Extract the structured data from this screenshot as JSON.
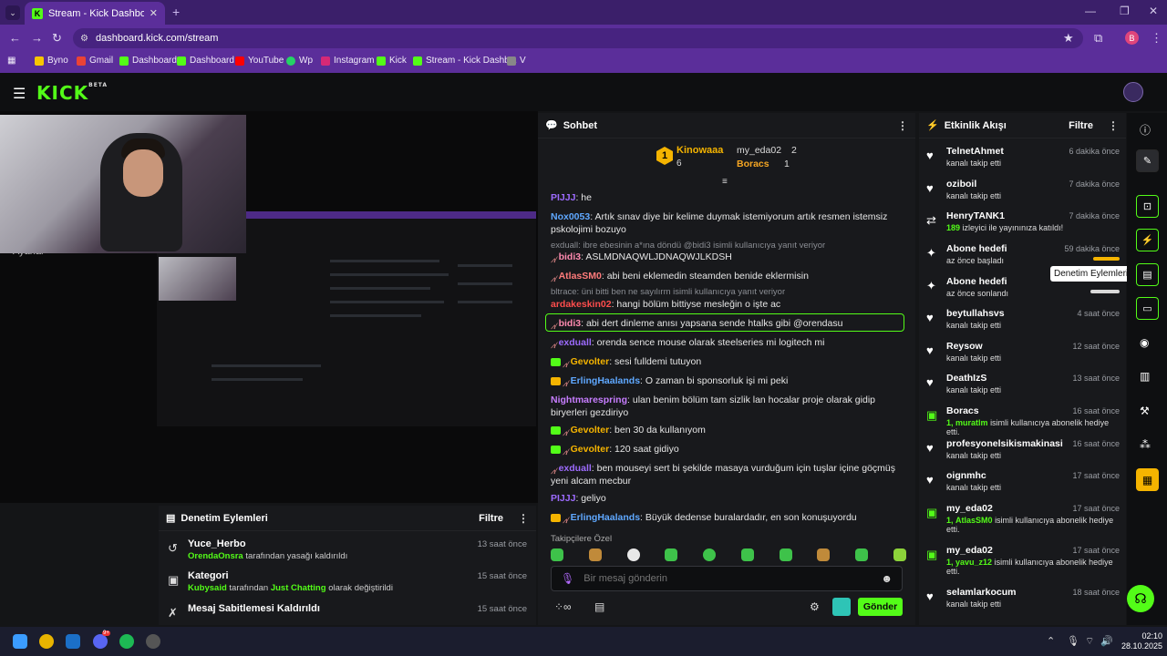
{
  "browser": {
    "tab_title": "Stream - Kick Dashboard",
    "url": "dashboard.kick.com/stream",
    "profile_initial": "B",
    "bookmarks": [
      "Byno",
      "Gmail",
      "Dashboard",
      "Dashboard",
      "YouTube",
      "Wp",
      "Instagram",
      "Kick",
      "Stream - Kick Dashb...",
      "V"
    ]
  },
  "stream": {
    "settings_label": "Ayarlar",
    "title_fragment": "i"
  },
  "chat": {
    "title": "Sohbet",
    "leaderboard": {
      "first": {
        "name": "Kinowaaa",
        "count": "6",
        "rank": "1"
      },
      "second": {
        "name": "my_eda02",
        "count": "2"
      },
      "third": {
        "name": "Boracs",
        "count": "1"
      }
    },
    "messages": [
      {
        "user": "PIJJJ",
        "color": "#9d6bff",
        "text": "he"
      },
      {
        "user": "Nox0053",
        "color": "#5fa8ff",
        "text": "Artık sınav diye bir kelime duymak istemiyorum artık resmen istemsiz pskolojimi bozuyo"
      },
      {
        "reply": "exduall: ibre ebesinin a*ına döndü @bidi3 isimli kullanıcıya yanıt veriyor"
      },
      {
        "user": "bidi3",
        "color": "#ff8ab0",
        "text": "ASLMDNAQWLJDNAQWJLKDSH"
      },
      {
        "user": "AtlasSM0",
        "color": "#ff7b7b",
        "text": "abi beni eklemedin steamden benide eklermisin"
      },
      {
        "reply": "bltrace: üni bitti ben ne sayılırm isimli kullanıcıya yanıt veriyor"
      },
      {
        "user": "ardakeskin02",
        "color": "#ff4d4d",
        "text": "hangi bölüm bittiyse mesleğin o işte ac"
      },
      {
        "user": "bidi3",
        "color": "#ff8ab0",
        "text": "abi dert dinleme anısı yapsana sende htalks gibi @orendasu"
      },
      {
        "user": "exduall",
        "color": "#9d6bff",
        "text": "orenda sence mouse olarak steelseries mi logitech mi"
      },
      {
        "user": "Gevolter",
        "color": "#f5b400",
        "text": "sesi fulldemi tutuyon"
      },
      {
        "user": "ErlingHaalands",
        "color": "#5fa8ff",
        "text": "O zaman bi sponsorluk işi mi peki"
      },
      {
        "user": "Nightmarespring",
        "color": "#c77dff",
        "text": "ulan benim bölüm tam sizlik lan hocalar proje olarak gidip biryerleri gezdiriyo"
      },
      {
        "user": "Gevolter",
        "color": "#f5b400",
        "text": "ben 30 da kullanıyom"
      },
      {
        "user": "Gevolter",
        "color": "#f5b400",
        "text": "120 saat gidiyo"
      },
      {
        "user": "exduall",
        "color": "#9d6bff",
        "text": "ben mouseyi sert bi şekilde masaya vurduğum için tuşlar içine göçmüş yeni alcam mecbur"
      },
      {
        "user": "PIJJJ",
        "color": "#9d6bff",
        "text": "geliyo"
      },
      {
        "user": "ErlingHaalands",
        "color": "#5fa8ff",
        "text": "Büyük dedense buralardadır, en son konuşuyordu"
      }
    ],
    "followers_only": "Takipçilere Özel",
    "input_placeholder": "Bir mesaj gönderin",
    "send_label": "Gönder"
  },
  "mod_actions": {
    "title": "Denetim Eylemleri",
    "filter_label": "Filtre",
    "items": [
      {
        "title": "Yuce_Herbo",
        "actor": "OrendaOnsra",
        "text": "tarafından yasağı kaldırıldı",
        "time": "13 saat önce",
        "icon": "unban-icon"
      },
      {
        "title": "Kategori",
        "actor": "Kubysaid",
        "text": "tarafından",
        "highlight": "Just Chatting",
        "text2": "olarak değiştirildi",
        "time": "15 saat önce",
        "icon": "category-icon"
      },
      {
        "title": "Mesaj Sabitlemesi Kaldırıldı",
        "time": "15 saat önce",
        "icon": "unpin-icon"
      }
    ]
  },
  "activity": {
    "title": "Etkinlik Akışı",
    "filter_label": "Filtre",
    "tooltip": "Denetim Eylemleri",
    "items": [
      {
        "name": "TelnetAhmet",
        "sub": "kanalı takip etti",
        "time": "6 dakika önce",
        "icon": "heart-icon"
      },
      {
        "name": "oziboil",
        "sub": "kanalı takip etti",
        "time": "7 dakika önce",
        "icon": "heart-icon"
      },
      {
        "name": "HenryTANK1",
        "count": "189",
        "sub": "izleyici ile yayınınıza katıldı!",
        "time": "7 dakika önce",
        "icon": "raid-icon"
      },
      {
        "name": "Abone hedefi",
        "sub": "az önce başladı",
        "time": "59 dakika önce",
        "icon": "sparkle-icon",
        "progress": 0.9
      },
      {
        "name": "Abone hedefi",
        "sub": "az önce sonlandı",
        "time": "",
        "icon": "sparkle-icon",
        "progress": 1.0
      },
      {
        "name": "beytullahsvs",
        "sub": "kanalı takip etti",
        "time": "4 saat önce",
        "icon": "heart-icon"
      },
      {
        "name": "Reysow",
        "sub": "kanalı takip etti",
        "time": "12 saat önce",
        "icon": "heart-icon"
      },
      {
        "name": "DeathIzS",
        "sub": "kanalı takip etti",
        "time": "13 saat önce",
        "icon": "heart-icon"
      },
      {
        "name": "Boracs",
        "count": "1,",
        "gift_user": "muratlm",
        "sub": "isimli kullanıcıya abonelik hediye etti.",
        "time": "16 saat önce",
        "icon": "gift-icon"
      },
      {
        "name": "profesyonelsikismakinasi",
        "sub": "kanalı takip etti",
        "time": "16 saat önce",
        "icon": "heart-icon"
      },
      {
        "name": "oignmhc",
        "sub": "kanalı takip etti",
        "time": "17 saat önce",
        "icon": "heart-icon"
      },
      {
        "name": "my_eda02",
        "count": "1,",
        "gift_user": "AtlasSM0",
        "sub": "isimli kullanıcıya abonelik hediye etti.",
        "time": "17 saat önce",
        "icon": "gift-icon"
      },
      {
        "name": "my_eda02",
        "count": "1,",
        "gift_user": "yavu_z12",
        "sub": "isimli kullanıcıya abonelik hediye etti.",
        "time": "17 saat önce",
        "icon": "gift-icon"
      },
      {
        "name": "selamlarkocum",
        "sub": "kanalı takip etti",
        "time": "18 saat önce",
        "icon": "heart-icon"
      }
    ]
  },
  "taskbar": {
    "time": "02:10",
    "date": "28.10.2025",
    "discord_badge": "9+"
  },
  "colors": {
    "accent": "#53fc18",
    "browser": "#5b2e9a",
    "panel": "#18191c"
  }
}
